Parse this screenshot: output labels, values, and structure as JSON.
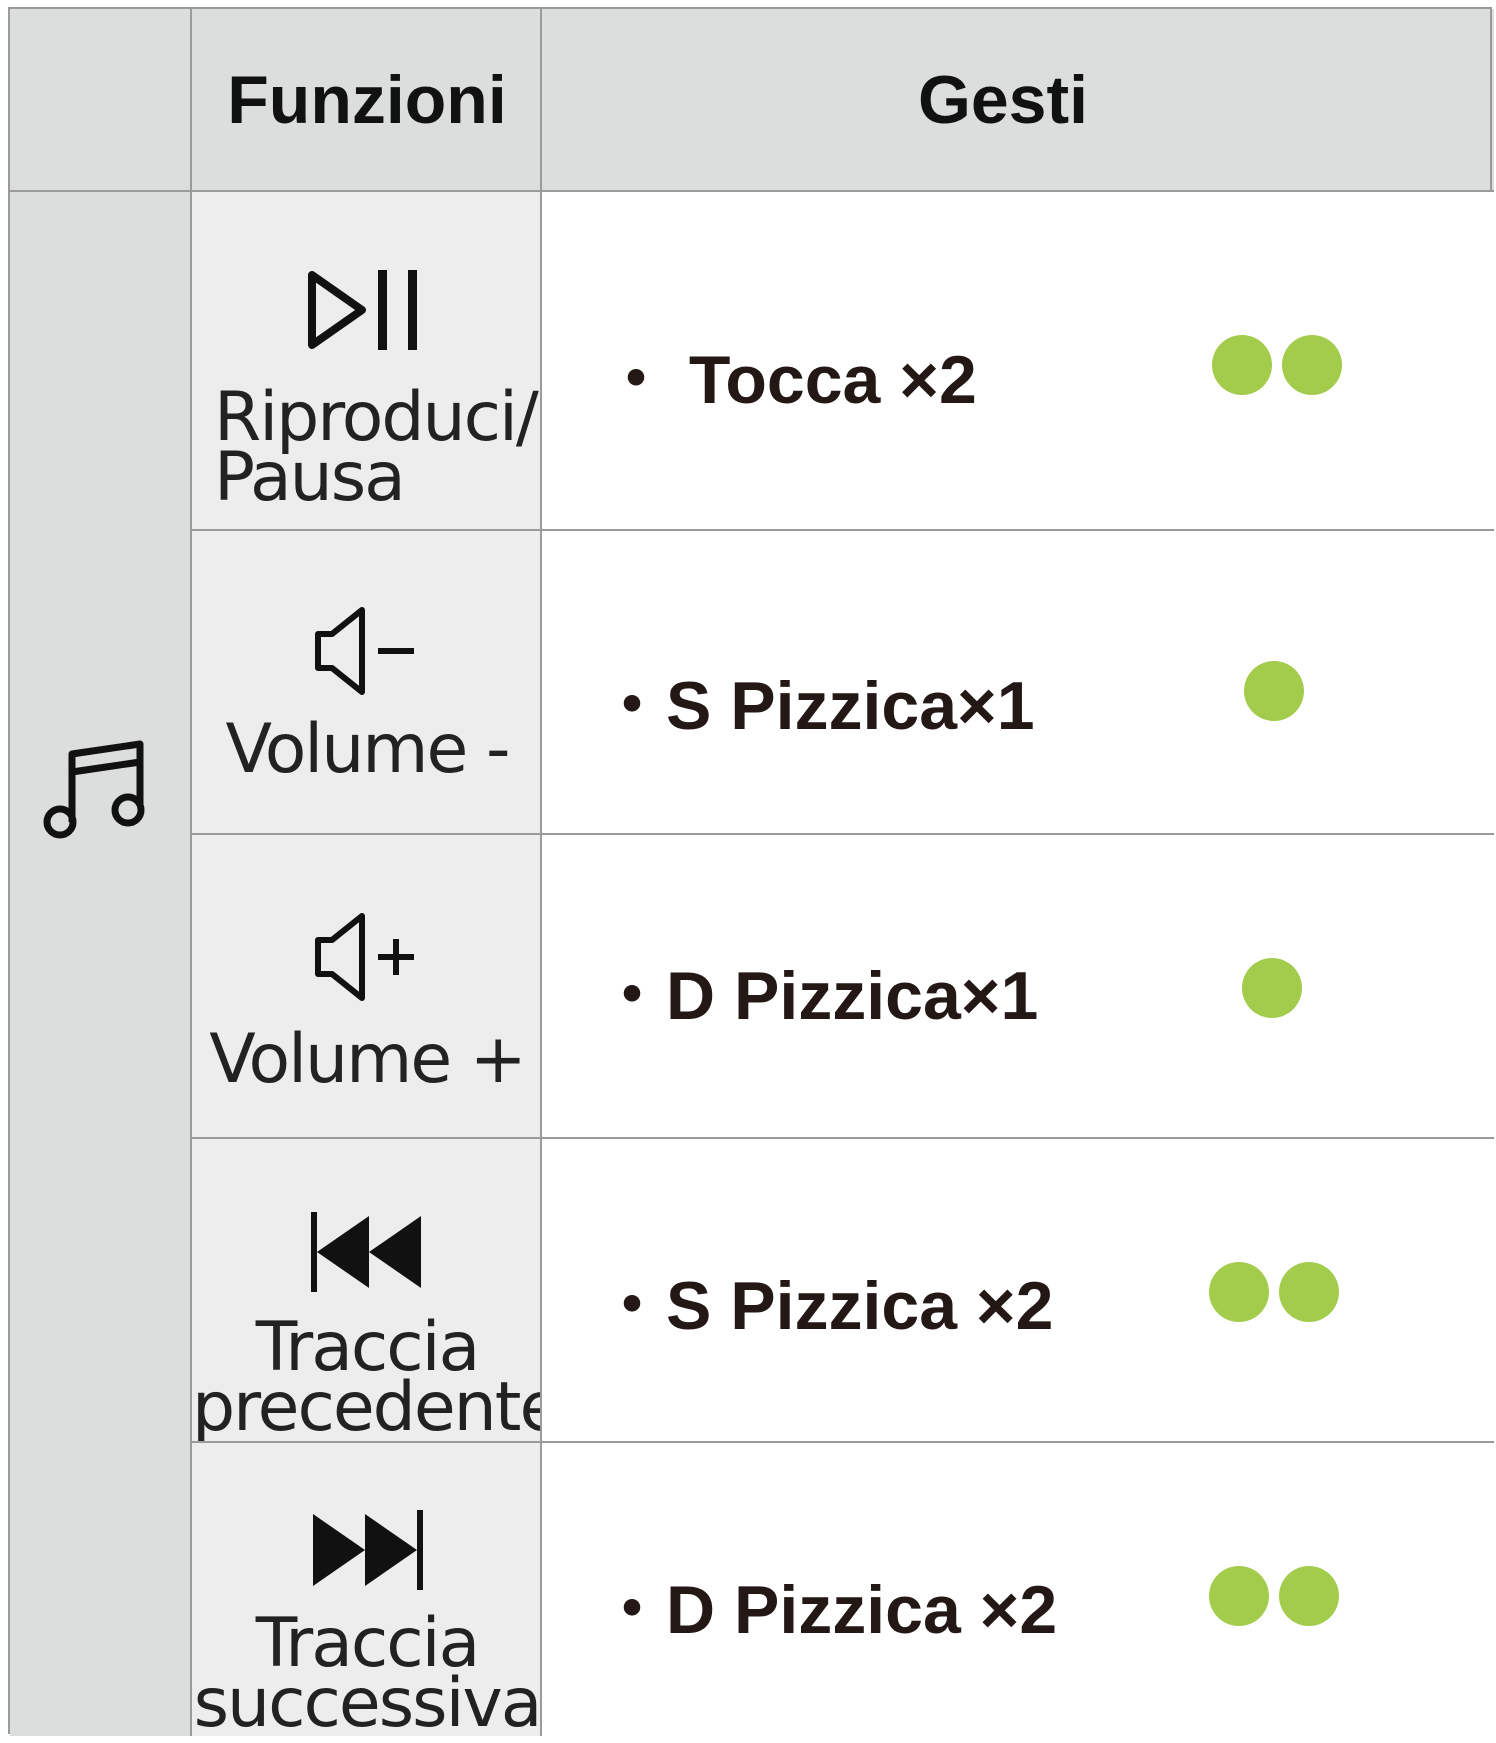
{
  "header": {
    "functions_label": "Funzioni",
    "gestures_label": "Gesti"
  },
  "category": {
    "icon": "music-note-icon"
  },
  "colors": {
    "dot": "#a3cb4c",
    "header_bg": "#dcdedd",
    "function_bg": "#ededed"
  },
  "rows": [
    {
      "icon": "play-pause-icon",
      "label_lines": [
        "Riproduci/",
        "Pausa"
      ],
      "gesture": "・ Tocca ×2",
      "dots": 2
    },
    {
      "icon": "volume-down-icon",
      "label_lines": [
        "Volume -"
      ],
      "gesture": "・S Pizzica×1",
      "dots": 1
    },
    {
      "icon": "volume-up-icon",
      "label_lines": [
        "Volume +"
      ],
      "gesture": "・D Pizzica×1",
      "dots": 1
    },
    {
      "icon": "previous-track-icon",
      "label_lines": [
        "Traccia",
        "precedente"
      ],
      "gesture": "・S Pizzica ×2",
      "dots": 2
    },
    {
      "icon": "next-track-icon",
      "label_lines": [
        "Traccia",
        "successiva"
      ],
      "gesture": "・D Pizzica ×2",
      "dots": 2
    }
  ]
}
